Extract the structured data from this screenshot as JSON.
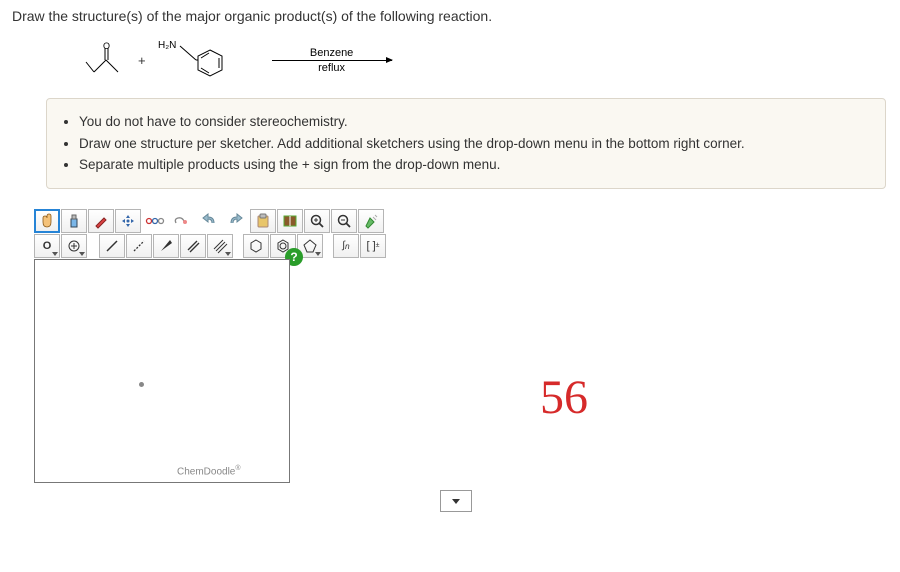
{
  "question": "Draw the structure(s) of the major organic product(s) of the following reaction.",
  "reaction": {
    "label1": "H₂N",
    "plus": "+",
    "condition_top": "Benzene",
    "condition_bottom": "reflux"
  },
  "instructions": {
    "items": [
      "You do not have to consider stereochemistry.",
      "Draw one structure per sketcher. Add additional sketchers using the drop-down menu in the bottom right corner.",
      "Separate multiple products using the + sign from the drop-down menu."
    ]
  },
  "toolbar_row1": [
    {
      "name": "hand-tool",
      "interact": true
    },
    {
      "name": "spray-tool",
      "interact": true
    },
    {
      "name": "pen-tool",
      "interact": true
    },
    {
      "name": "move-tool",
      "interact": true
    },
    {
      "name": "chain-tool",
      "interact": true
    },
    {
      "name": "erase-tool",
      "interact": true
    },
    {
      "name": "undo-tool",
      "interact": true
    },
    {
      "name": "redo-tool",
      "interact": true
    },
    {
      "name": "paste-tool",
      "interact": true
    },
    {
      "name": "book-tool",
      "interact": true
    },
    {
      "name": "zoom-in-tool",
      "interact": true
    },
    {
      "name": "zoom-out-tool",
      "interact": true
    },
    {
      "name": "clean-tool",
      "interact": true
    }
  ],
  "toolbar_row2_atom": "O",
  "chemdoodle": "ChemDoodle",
  "help": "?",
  "annotation": "56",
  "n_label": "n"
}
